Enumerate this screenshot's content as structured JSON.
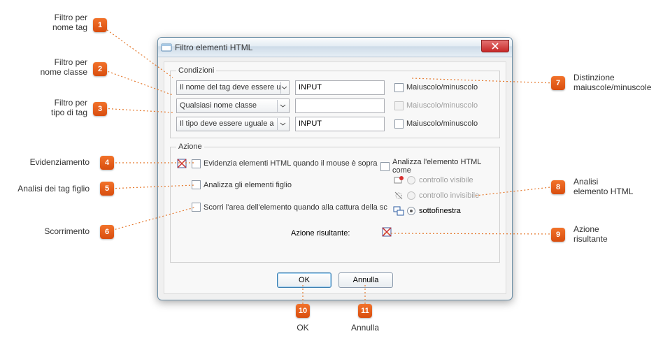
{
  "dialog": {
    "title": "Filtro elementi HTML",
    "conditions": {
      "legend": "Condizioni",
      "rows": [
        {
          "combo": "Il nome del tag deve essere u",
          "value": "INPUT",
          "case_label": "Maiuscolo/minuscolo",
          "case_enabled": true
        },
        {
          "combo": "Qualsiasi nome classe",
          "value": "",
          "case_label": "Maiuscolo/minuscolo",
          "case_enabled": false
        },
        {
          "combo": "Il tipo deve essere uguale a",
          "value": "INPUT",
          "case_label": "Maiuscolo/minuscolo",
          "case_enabled": true
        }
      ]
    },
    "action": {
      "legend": "Azione",
      "highlight_label": "Evidenzia elementi HTML quando il mouse è sopra",
      "analyze_children_label": "Analizza gli elementi figlio",
      "scroll_label": "Scorri l'area dell'elemento quando alla cattura della sc",
      "analyze_as_label": "Analizza l'elemento HTML come",
      "radio_visible": "controllo visibile",
      "radio_invisible": "controllo invisibile",
      "radio_subwindow": "sottofinestra",
      "resulting_label": "Azione risultante:"
    },
    "buttons": {
      "ok": "OK",
      "cancel": "Annulla"
    }
  },
  "callouts": {
    "c1": "Filtro per\nnome tag",
    "c2": "Filtro per\nnome classe",
    "c3": "Filtro per\ntipo di tag",
    "c4": "Evidenziamento",
    "c5": "Analisi dei tag figlio",
    "c6": "Scorrimento",
    "c7": "Distinzione\nmaiuscole/minuscole",
    "c8": "Analisi\nelemento HTML",
    "c9": "Azione\nrisultante",
    "c10": "OK",
    "c11": "Annulla"
  },
  "markers": {
    "m1": "1",
    "m2": "2",
    "m3": "3",
    "m4": "4",
    "m5": "5",
    "m6": "6",
    "m7": "7",
    "m8": "8",
    "m9": "9",
    "m10": "10",
    "m11": "11"
  }
}
